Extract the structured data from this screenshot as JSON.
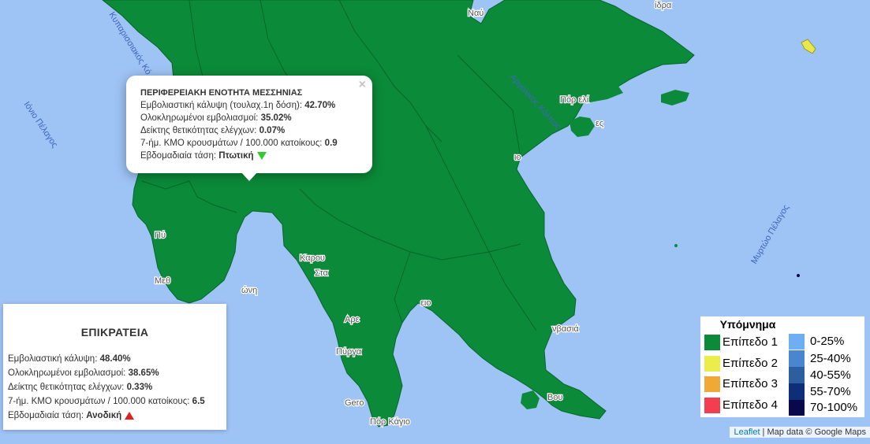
{
  "map": {
    "colors": {
      "sea": "#9ec3f5",
      "land_level1": "#0b8a39",
      "border": "#06662a",
      "outside_land": "#ffffff"
    },
    "water_labels": {
      "ionian": "Ιόνιο Πέλαγος",
      "kyparissia": "Κυπαρισσιακός Κό",
      "argolic": "Αργολικός Κόλπος",
      "myrtoan": "Μυρτώο Πέλαγος"
    },
    "place_labels": {
      "nafplio": "Ναύ",
      "porto_heli": "Πόρ   ελί",
      "spetses": "ες",
      "karoupis": "Καρου",
      "stoupa": "Στα",
      "methoni": "Μεθ",
      "koroni": "ώνη",
      "gerolimenas": "Gero",
      "areopoli": "Αρε",
      "pyrgos": "Πύργα",
      "monemvasia": "νβασιά",
      "porto_kagio": "Πόρ   Κάγιο",
      "gythio": "ειο",
      "boiai": "Βου",
      "leonidio": "ιο",
      "pylos": "Πύ",
      "methana": "ίδρα"
    }
  },
  "popup": {
    "close": "×",
    "title": "ΠΕΡΙΦΕΡΕΙΑΚΗ ΕΝΟΤΗΤΑ ΜΕΣΣΗΝΙΑΣ",
    "coverage_label": "Εμβολιαστική κάλυψη (τουλαχ.1η δόση):",
    "coverage_value": "42.70%",
    "full_label": "Ολοκληρωμένοι εμβολιασμοί:",
    "full_value": "35.02%",
    "positivity_label": "Δείκτης θετικότητας ελέγχων:",
    "positivity_value": "0.07%",
    "cases_label": "7-ήμ. ΚΜΟ κρουσμάτων / 100.000 κατοίκους:",
    "cases_value": "0.9",
    "trend_label": "Εβδομαδιαία τάση:",
    "trend_value": "Πτωτική",
    "trend_icon": "arrow-down-green"
  },
  "country": {
    "title": "ΕΠΙΚΡΑΤΕΙΑ",
    "coverage_label": "Εμβολιαστική κάλυψη:",
    "coverage_value": "48.40%",
    "full_label": "Ολοκληρωμένοι εμβολιασμοί:",
    "full_value": "38.65%",
    "positivity_label": "Δείκτης θετικότητας ελέγχων:",
    "positivity_value": "0.33%",
    "cases_label": "7-ήμ. ΚΜΟ κρουσμάτων / 100.000 κατοίκους:",
    "cases_value": "6.5",
    "trend_label": "Εβδομαδιαία τάση:",
    "trend_value": "Ανοδική",
    "trend_icon": "arrow-up-red"
  },
  "legend": {
    "title": "Υπόμνημα",
    "levels": [
      {
        "label": "Επίπεδο 1",
        "color": "#0b8a39"
      },
      {
        "label": "Επίπεδο 2",
        "color": "#ecec4a"
      },
      {
        "label": "Επίπεδο 3",
        "color": "#f0a836"
      },
      {
        "label": "Επίπεδο 4",
        "color": "#f23e4f"
      }
    ],
    "coverage": [
      {
        "label": "0-25%",
        "color": "#6faef2"
      },
      {
        "label": "25-40%",
        "color": "#4a86cf"
      },
      {
        "label": "40-55%",
        "color": "#2c5f9f"
      },
      {
        "label": "55-70%",
        "color": "#0d2f78"
      },
      {
        "label": "70-100%",
        "color": "#08084a"
      }
    ]
  },
  "attribution": {
    "leaflet": "Leaflet",
    "separator": " | ",
    "credit": "Map data © Google Maps"
  }
}
